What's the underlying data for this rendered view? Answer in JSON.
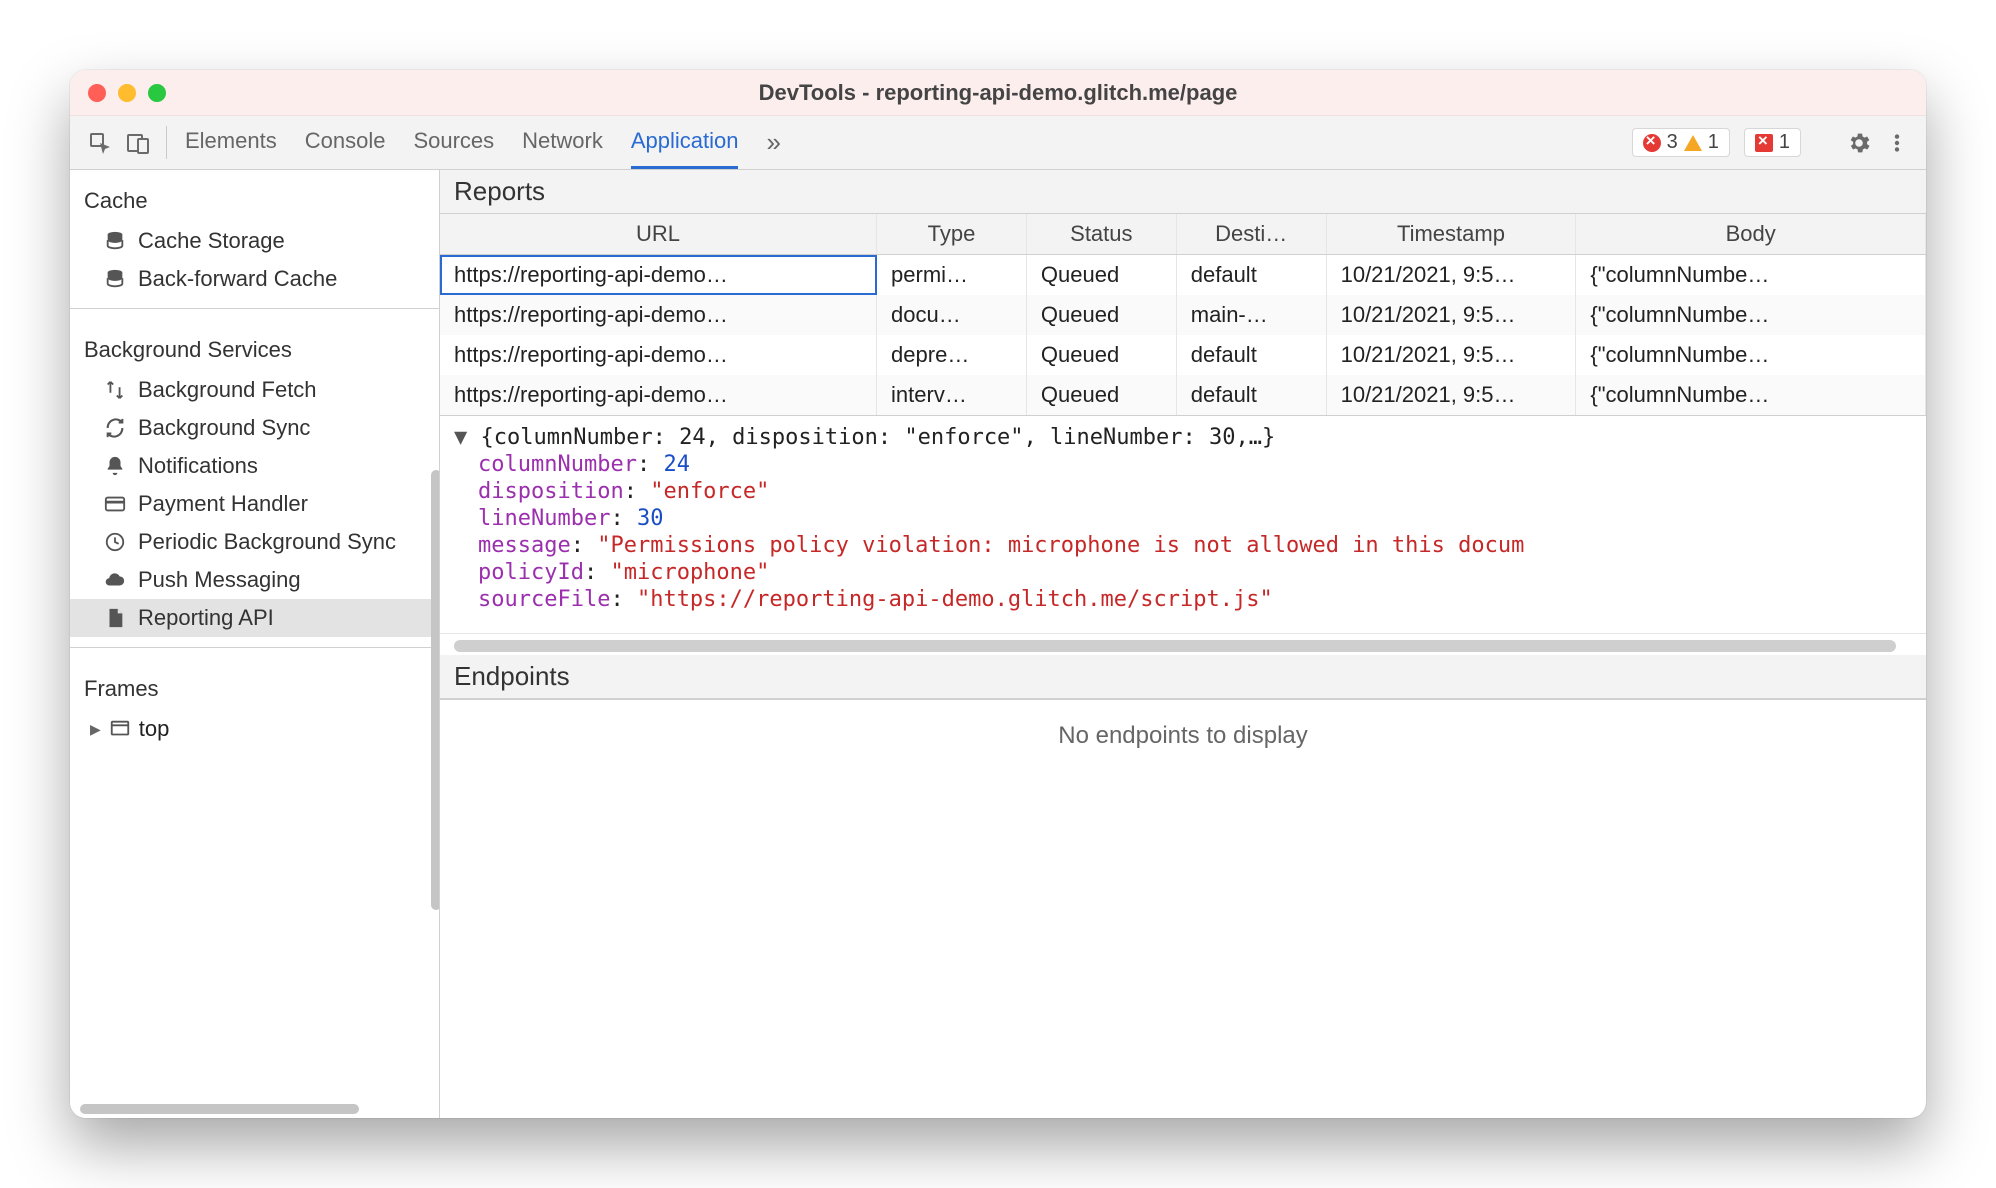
{
  "window": {
    "title": "DevTools - reporting-api-demo.glitch.me/page"
  },
  "toolbar": {
    "tabs": [
      "Elements",
      "Console",
      "Sources",
      "Network",
      "Application"
    ],
    "active_tab": "Application",
    "errors_count": "3",
    "warnings_count": "1",
    "issues_count": "1"
  },
  "sidebar": {
    "sections": {
      "cache": {
        "title": "Cache",
        "items": [
          "Cache Storage",
          "Back-forward Cache"
        ]
      },
      "background_services": {
        "title": "Background Services",
        "items": [
          "Background Fetch",
          "Background Sync",
          "Notifications",
          "Payment Handler",
          "Periodic Background Sync",
          "Push Messaging",
          "Reporting API"
        ],
        "selected": "Reporting API"
      },
      "frames": {
        "title": "Frames",
        "items": [
          "top"
        ]
      }
    }
  },
  "reports": {
    "section_title": "Reports",
    "columns": [
      "URL",
      "Type",
      "Status",
      "Desti…",
      "Timestamp",
      "Body"
    ],
    "rows": [
      {
        "url": "https://reporting-api-demo…",
        "type": "permi…",
        "status": "Queued",
        "dest": "default",
        "time": "10/21/2021, 9:5…",
        "body": "{\"columnNumbe…"
      },
      {
        "url": "https://reporting-api-demo…",
        "type": "docu…",
        "status": "Queued",
        "dest": "main-…",
        "time": "10/21/2021, 9:5…",
        "body": "{\"columnNumbe…"
      },
      {
        "url": "https://reporting-api-demo…",
        "type": "depre…",
        "status": "Queued",
        "dest": "default",
        "time": "10/21/2021, 9:5…",
        "body": "{\"columnNumbe…"
      },
      {
        "url": "https://reporting-api-demo…",
        "type": "interv…",
        "status": "Queued",
        "dest": "default",
        "time": "10/21/2021, 9:5…",
        "body": "{\"columnNumbe…"
      }
    ],
    "selected_index": 0
  },
  "details": {
    "summary": "{columnNumber: 24, disposition: \"enforce\", lineNumber: 30,…}",
    "props": {
      "columnNumber": "24",
      "disposition": "\"enforce\"",
      "lineNumber": "30",
      "message": "\"Permissions policy violation: microphone is not allowed in this docum",
      "policyId": "\"microphone\"",
      "sourceFile": "\"https://reporting-api-demo.glitch.me/script.js\""
    }
  },
  "endpoints": {
    "section_title": "Endpoints",
    "empty_text": "No endpoints to display"
  }
}
